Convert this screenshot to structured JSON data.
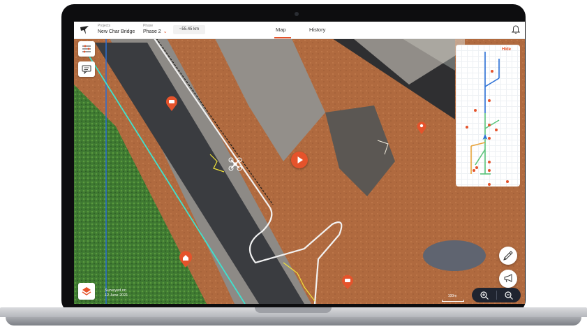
{
  "header": {
    "projects_label": "Projects",
    "project_name": "New Char Bridge",
    "phase_label": "Phase",
    "phase_value": "Phase 2",
    "distance": "~55.45 km",
    "tabs": [
      {
        "label": "Map",
        "active": true
      },
      {
        "label": "History",
        "active": false
      }
    ]
  },
  "minimap": {
    "hide_label": "Hide"
  },
  "map": {
    "surveyed_label": "Surveyed on",
    "surveyed_date": "12 June 2021",
    "scale_label": "100m"
  },
  "colors": {
    "accent": "#e5532b",
    "route_blue": "#2a6fd6",
    "route_cyan": "#3de3d0",
    "route_white": "#f2f2f2",
    "zoom_bg": "#1f2430"
  },
  "icons": [
    "bird-logo-icon",
    "chevron-down-icon",
    "bell-icon",
    "filter-sliders-icon",
    "comment-icon",
    "layers-icon",
    "hand-draw-icon",
    "megaphone-icon",
    "zoom-in-icon",
    "zoom-out-icon",
    "play-icon",
    "drone-icon"
  ]
}
